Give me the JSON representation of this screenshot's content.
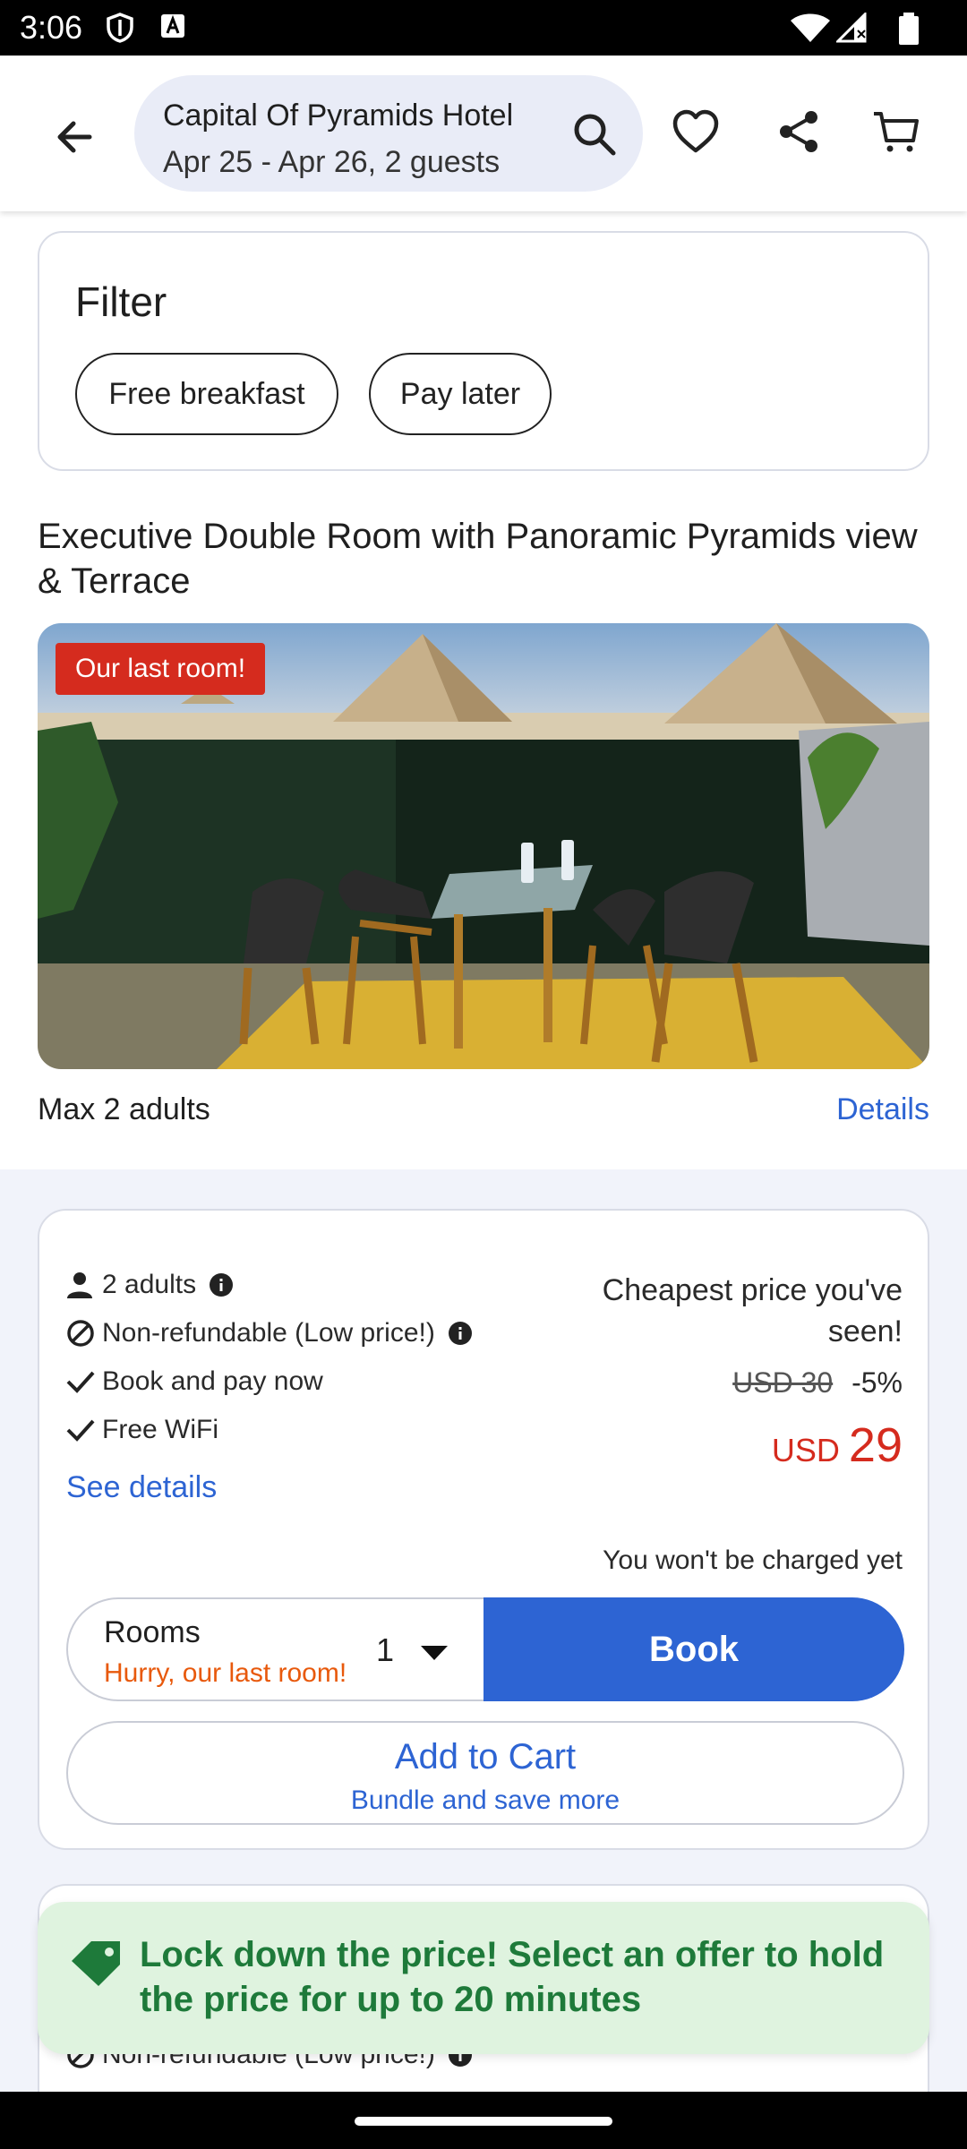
{
  "status_bar": {
    "time": "3:06"
  },
  "header": {
    "hotel_name": "Capital Of Pyramids Hotel",
    "stay_info": "Apr 25 - Apr 26, 2 guests"
  },
  "filter": {
    "title": "Filter",
    "chips": [
      "Free breakfast",
      "Pay later"
    ]
  },
  "room": {
    "title": "Executive Double Room with Panoramic Pyramids view & Terrace",
    "badge": "Our last room!",
    "max_occupancy": "Max 2 adults",
    "details_link": "Details"
  },
  "offer": {
    "features": [
      {
        "icon": "person-icon",
        "text": "2 adults",
        "info": true
      },
      {
        "icon": "no-refund-icon",
        "text": "Non-refundable (Low price!)",
        "info": true
      },
      {
        "icon": "check-icon",
        "text": "Book and pay now",
        "info": false
      },
      {
        "icon": "check-icon",
        "text": "Free WiFi",
        "info": false
      }
    ],
    "see_details": "See details",
    "cheapest_note": "Cheapest price you've seen!",
    "old_price": "USD 30",
    "discount": "-5%",
    "currency": "USD",
    "price": "29",
    "charge_note": "You won't be charged yet",
    "rooms_label": "Rooms",
    "rooms_urgency": "Hurry, our last room!",
    "rooms_count": "1",
    "book_label": "Book",
    "cart_label": "Add to Cart",
    "cart_sub": "Bundle and save more"
  },
  "offer2": {
    "partial_feature": "Non-refundable (Low price!)"
  },
  "lock_banner": {
    "text": "Lock down the price! Select an offer to hold the price for up to 20 minutes"
  },
  "colors": {
    "accent_blue": "#2d64d3",
    "price_red": "#d52b1e",
    "urgency_orange": "#e8590c",
    "banner_green_bg": "#dff3df",
    "banner_green_text": "#1e7a3a"
  }
}
